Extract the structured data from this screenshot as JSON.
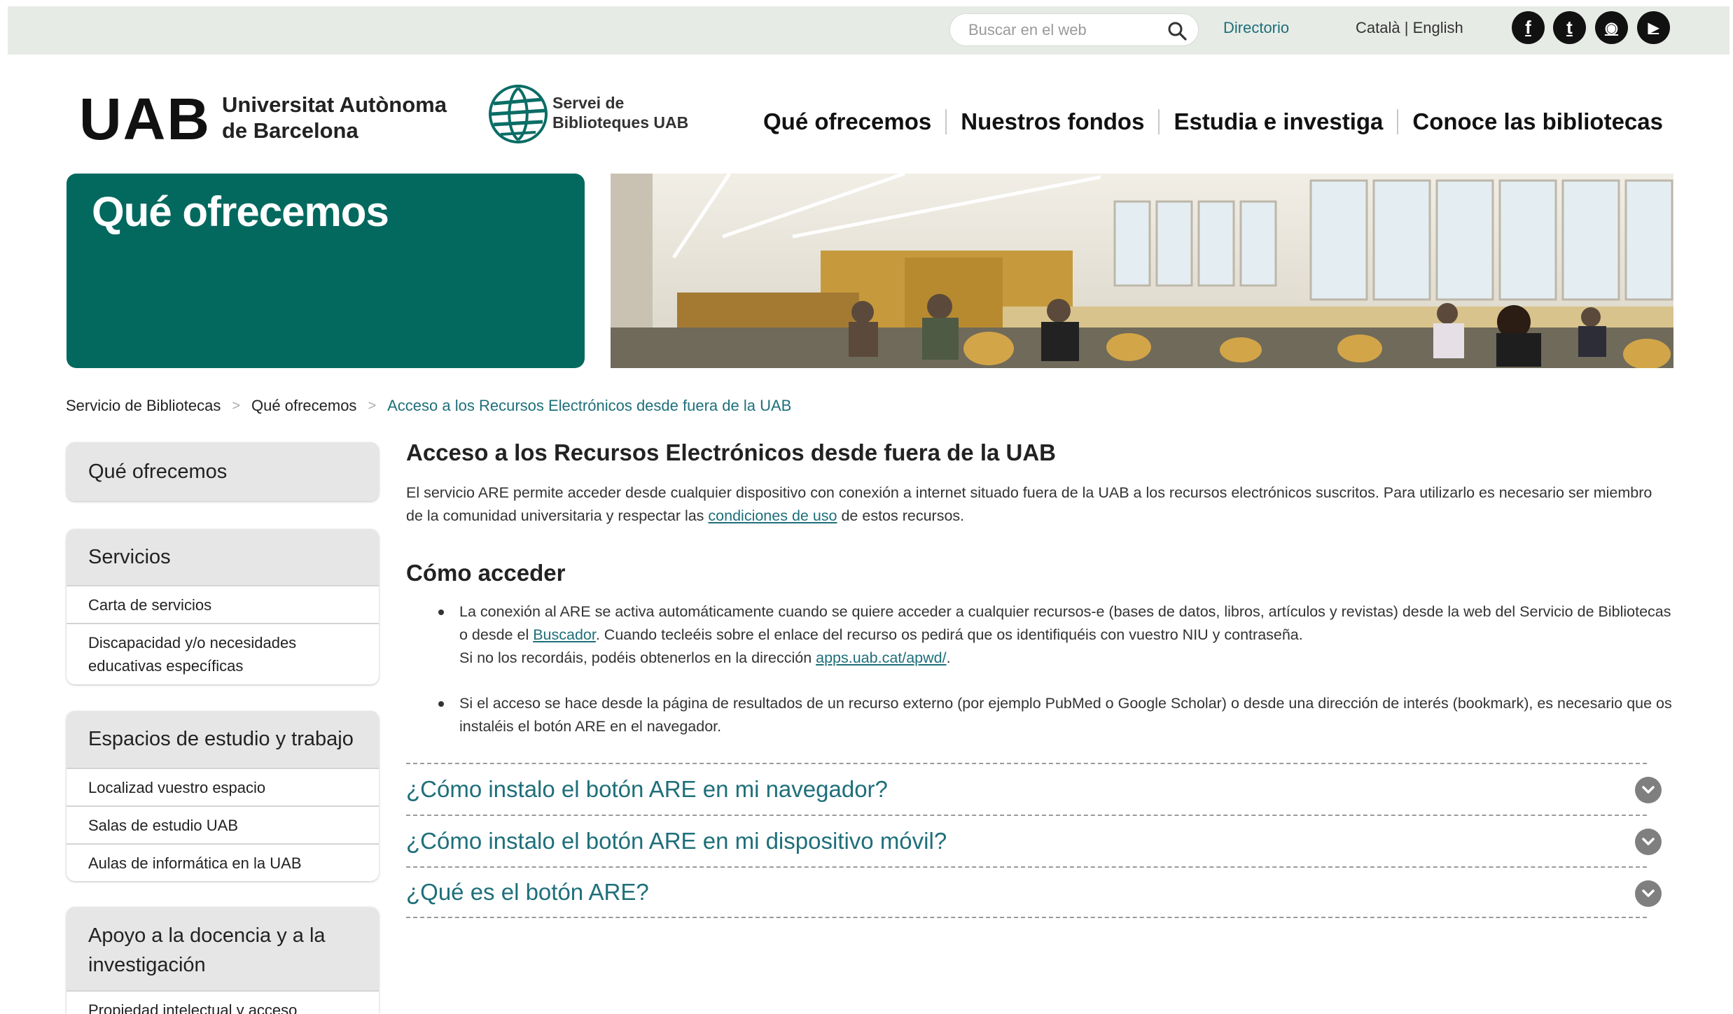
{
  "topbar": {
    "search_placeholder": "Buscar en el web",
    "directory_link": "Directorio",
    "lang_catala": "Català",
    "lang_separator": "|",
    "lang_english": "English",
    "social": [
      {
        "icon": "facebook-icon",
        "glyph": "f"
      },
      {
        "icon": "twitter-icon",
        "glyph": "t"
      },
      {
        "icon": "instagram-icon",
        "glyph": "◉"
      },
      {
        "icon": "youtube-icon",
        "glyph": "▶"
      }
    ]
  },
  "header": {
    "logo_text": "UAB",
    "university_line1": "Universitat Autònoma",
    "university_line2": "de Barcelona",
    "library_line1": "Servei de",
    "library_line2": "Biblioteques UAB",
    "nav": [
      "Qué ofrecemos",
      "Nuestros fondos",
      "Estudia e investiga",
      "Conoce las bibliotecas"
    ]
  },
  "hero": {
    "title": "Qué ofrecemos"
  },
  "breadcrumb": {
    "items": [
      "Servicio de Bibliotecas",
      "Qué ofrecemos",
      "Acceso a los Recursos Electrónicos desde fuera de la UAB"
    ],
    "separator": ">"
  },
  "sidebar": {
    "sections": [
      {
        "title": "Qué ofrecemos",
        "items": []
      },
      {
        "title": "Servicios",
        "items": [
          "Carta de servicios",
          "Discapacidad y/o necesidades educativas específicas"
        ]
      },
      {
        "title": "Espacios de estudio y trabajo",
        "items": [
          "Localizad vuestro espacio",
          "Salas de estudio UAB",
          "Aulas de informática en la UAB"
        ]
      },
      {
        "title": "Apoyo a la docencia y a la investigación",
        "items": [
          "Propiedad intelectual y acceso"
        ]
      }
    ]
  },
  "content": {
    "title": "Acceso a los Recursos Electrónicos desde fuera de la UAB",
    "intro_before": "El servicio ARE permite acceder desde cualquier dispositivo con conexión a internet situado fuera de la UAB a los recursos electrónicos suscritos. Para utilizarlo es necesario ser miembro de la comunidad universitaria y respectar las ",
    "intro_link": "condiciones de uso",
    "intro_after": " de estos recursos.",
    "how_title": "Cómo acceder",
    "bullet1_a": "La conexión al ARE se activa automáticamente cuando se quiere acceder a cualquier recursos-e (bases de datos, libros, artículos y revistas) desde la web del Servicio de Bibliotecas o desde el ",
    "bullet1_link1": "Buscador",
    "bullet1_b": ". Cuando tecleéis sobre el enlace del recurso os pedirá que os identifiquéis con vuestro NIU y contraseña.",
    "bullet1_c": "Si no los recordáis, podéis obtenerlos en la dirección ",
    "bullet1_link2": "apps.uab.cat/apwd/",
    "bullet1_d": ".",
    "bullet2": "Si el acceso se hace desde la página de resultados de un recurso externo (por ejemplo PubMed o Google Scholar) o desde una dirección de interés (bookmark), es necesario que os instaléis el botón ARE en el navegador.",
    "faq": [
      "¿Cómo instalo el botón ARE en mi navegador?",
      "¿Cómo instalo el botón ARE en mi dispositivo móvil?",
      "¿Qué es el botón ARE?"
    ]
  },
  "colors": {
    "topbar_bg": "#e7ebe6",
    "hero_teal": "#03695f",
    "link_teal": "#1e6f7a",
    "accordion_toggle": "#7f7f7f"
  }
}
